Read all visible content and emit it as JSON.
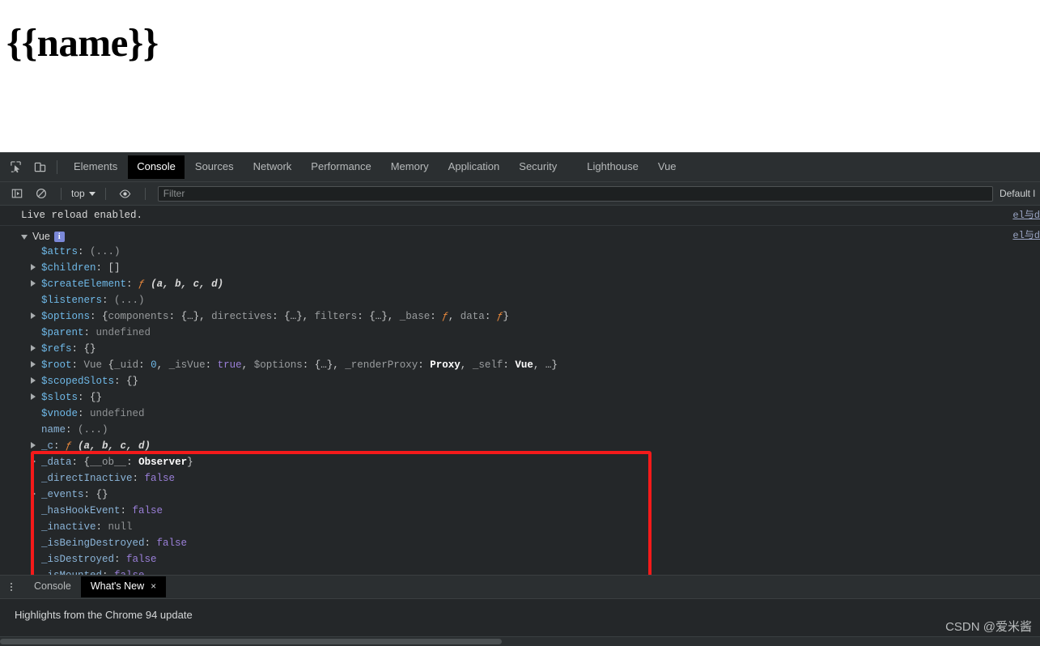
{
  "page": {
    "heading": "{{name}}"
  },
  "devtools": {
    "icons": {
      "inspect": "inspect-element-icon",
      "device": "device-toolbar-icon"
    },
    "tabs": [
      {
        "label": "Elements",
        "active": false
      },
      {
        "label": "Console",
        "active": true
      },
      {
        "label": "Sources",
        "active": false
      },
      {
        "label": "Network",
        "active": false
      },
      {
        "label": "Performance",
        "active": false
      },
      {
        "label": "Memory",
        "active": false
      },
      {
        "label": "Application",
        "active": false
      },
      {
        "label": "Security",
        "active": false
      },
      {
        "label": "Lighthouse",
        "active": false
      },
      {
        "label": "Vue",
        "active": false
      }
    ]
  },
  "console_toolbar": {
    "sidebar_toggle_icon": "console-sidebar-icon",
    "clear_icon": "clear-console-icon",
    "context": "top",
    "eye_icon": "live-expression-eye-icon",
    "filter_placeholder": "Filter",
    "filter_value": "",
    "levels": "Default l"
  },
  "console": {
    "messages": [
      {
        "text": "Live reload enabled.",
        "source": "el与d"
      }
    ],
    "object_group": {
      "label": "Vue",
      "badge": "i",
      "source": "el与d",
      "properties": [
        {
          "expandable": false,
          "key": "$attrs",
          "key_style": "own",
          "parts": [
            {
              "t": ": ",
              "c": "punct"
            },
            {
              "t": "(...)",
              "c": "v-dim"
            }
          ]
        },
        {
          "expandable": true,
          "key": "$children",
          "key_style": "own",
          "parts": [
            {
              "t": ": ",
              "c": "punct"
            },
            {
              "t": "[]",
              "c": "v-obj"
            }
          ]
        },
        {
          "expandable": true,
          "key": "$createElement",
          "key_style": "own",
          "parts": [
            {
              "t": ": ",
              "c": "punct"
            },
            {
              "t": "ƒ ",
              "c": "v-fn"
            },
            {
              "t": "(a, b, c, d)",
              "c": "v-args"
            }
          ]
        },
        {
          "expandable": false,
          "key": "$listeners",
          "key_style": "own",
          "parts": [
            {
              "t": ": ",
              "c": "punct"
            },
            {
              "t": "(...)",
              "c": "v-dim"
            }
          ]
        },
        {
          "expandable": true,
          "key": "$options",
          "key_style": "own",
          "parts": [
            {
              "t": ": ",
              "c": "punct"
            },
            {
              "t": "{",
              "c": "v-obj"
            },
            {
              "t": "components",
              "c": "v-dim"
            },
            {
              "t": ": ",
              "c": "punct"
            },
            {
              "t": "{…}",
              "c": "v-obj"
            },
            {
              "t": ", ",
              "c": "punct"
            },
            {
              "t": "directives",
              "c": "v-dim"
            },
            {
              "t": ": ",
              "c": "punct"
            },
            {
              "t": "{…}",
              "c": "v-obj"
            },
            {
              "t": ", ",
              "c": "punct"
            },
            {
              "t": "filters",
              "c": "v-dim"
            },
            {
              "t": ": ",
              "c": "punct"
            },
            {
              "t": "{…}",
              "c": "v-obj"
            },
            {
              "t": ", ",
              "c": "punct"
            },
            {
              "t": "_base",
              "c": "v-dim"
            },
            {
              "t": ": ",
              "c": "punct"
            },
            {
              "t": "ƒ",
              "c": "v-fn"
            },
            {
              "t": ", ",
              "c": "punct"
            },
            {
              "t": "data",
              "c": "v-dim"
            },
            {
              "t": ": ",
              "c": "punct"
            },
            {
              "t": "ƒ",
              "c": "v-fn"
            },
            {
              "t": "}",
              "c": "v-obj"
            }
          ]
        },
        {
          "expandable": false,
          "key": "$parent",
          "key_style": "own",
          "parts": [
            {
              "t": ": ",
              "c": "punct"
            },
            {
              "t": "undefined",
              "c": "v-undef"
            }
          ]
        },
        {
          "expandable": true,
          "key": "$refs",
          "key_style": "own",
          "parts": [
            {
              "t": ": ",
              "c": "punct"
            },
            {
              "t": "{}",
              "c": "v-obj"
            }
          ]
        },
        {
          "expandable": true,
          "key": "$root",
          "key_style": "own",
          "parts": [
            {
              "t": ": ",
              "c": "punct"
            },
            {
              "t": "Vue ",
              "c": "v-dim"
            },
            {
              "t": "{",
              "c": "v-obj"
            },
            {
              "t": "_uid",
              "c": "v-dim"
            },
            {
              "t": ": ",
              "c": "punct"
            },
            {
              "t": "0",
              "c": "v-num"
            },
            {
              "t": ", ",
              "c": "punct"
            },
            {
              "t": "_isVue",
              "c": "v-dim"
            },
            {
              "t": ": ",
              "c": "punct"
            },
            {
              "t": "true",
              "c": "v-bool"
            },
            {
              "t": ", ",
              "c": "punct"
            },
            {
              "t": "$options",
              "c": "v-dim"
            },
            {
              "t": ": ",
              "c": "punct"
            },
            {
              "t": "{…}",
              "c": "v-obj"
            },
            {
              "t": ", ",
              "c": "punct"
            },
            {
              "t": "_renderProxy",
              "c": "v-dim"
            },
            {
              "t": ": ",
              "c": "punct"
            },
            {
              "t": "Proxy",
              "c": "v-bold"
            },
            {
              "t": ", ",
              "c": "punct"
            },
            {
              "t": "_self",
              "c": "v-dim"
            },
            {
              "t": ": ",
              "c": "punct"
            },
            {
              "t": "Vue",
              "c": "v-bold"
            },
            {
              "t": ", …}",
              "c": "v-obj"
            }
          ]
        },
        {
          "expandable": true,
          "key": "$scopedSlots",
          "key_style": "own",
          "parts": [
            {
              "t": ": ",
              "c": "punct"
            },
            {
              "t": "{}",
              "c": "v-obj"
            }
          ]
        },
        {
          "expandable": true,
          "key": "$slots",
          "key_style": "own",
          "parts": [
            {
              "t": ": ",
              "c": "punct"
            },
            {
              "t": "{}",
              "c": "v-obj"
            }
          ]
        },
        {
          "expandable": false,
          "key": "$vnode",
          "key_style": "own",
          "parts": [
            {
              "t": ": ",
              "c": "punct"
            },
            {
              "t": "undefined",
              "c": "v-undef"
            }
          ]
        },
        {
          "expandable": false,
          "key": "name",
          "key_style": "plain",
          "parts": [
            {
              "t": ": ",
              "c": "punct"
            },
            {
              "t": "(...)",
              "c": "v-dim"
            }
          ]
        },
        {
          "expandable": true,
          "key": "_c",
          "key_style": "plain",
          "parts": [
            {
              "t": ": ",
              "c": "punct"
            },
            {
              "t": "ƒ ",
              "c": "v-fn"
            },
            {
              "t": "(a, b, c, d)",
              "c": "v-args"
            }
          ]
        },
        {
          "expandable": true,
          "key": "_data",
          "key_style": "plain",
          "parts": [
            {
              "t": ": ",
              "c": "punct"
            },
            {
              "t": "{",
              "c": "v-obj"
            },
            {
              "t": "__ob__",
              "c": "v-dim"
            },
            {
              "t": ": ",
              "c": "punct"
            },
            {
              "t": "Observer",
              "c": "v-bold"
            },
            {
              "t": "}",
              "c": "v-obj"
            }
          ]
        },
        {
          "expandable": false,
          "key": "_directInactive",
          "key_style": "plain",
          "parts": [
            {
              "t": ": ",
              "c": "punct"
            },
            {
              "t": "false",
              "c": "v-bool"
            }
          ]
        },
        {
          "expandable": true,
          "key": "_events",
          "key_style": "plain",
          "parts": [
            {
              "t": ": ",
              "c": "punct"
            },
            {
              "t": "{}",
              "c": "v-obj"
            }
          ]
        },
        {
          "expandable": false,
          "key": "_hasHookEvent",
          "key_style": "plain",
          "parts": [
            {
              "t": ": ",
              "c": "punct"
            },
            {
              "t": "false",
              "c": "v-bool"
            }
          ]
        },
        {
          "expandable": false,
          "key": "_inactive",
          "key_style": "plain",
          "parts": [
            {
              "t": ": ",
              "c": "punct"
            },
            {
              "t": "null",
              "c": "v-null"
            }
          ]
        },
        {
          "expandable": false,
          "key": "_isBeingDestroyed",
          "key_style": "plain",
          "parts": [
            {
              "t": ": ",
              "c": "punct"
            },
            {
              "t": "false",
              "c": "v-bool"
            }
          ]
        },
        {
          "expandable": false,
          "key": "_isDestroyed",
          "key_style": "plain",
          "parts": [
            {
              "t": ": ",
              "c": "punct"
            },
            {
              "t": "false",
              "c": "v-bool"
            }
          ]
        },
        {
          "expandable": false,
          "key": "_isMounted",
          "key_style": "plain",
          "parts": [
            {
              "t": ": ",
              "c": "punct"
            },
            {
              "t": "false",
              "c": "v-bool"
            }
          ]
        }
      ]
    }
  },
  "drawer": {
    "tabs": [
      {
        "label": "Console",
        "active": false,
        "closable": false
      },
      {
        "label": "What's New",
        "active": true,
        "closable": true
      }
    ],
    "close_glyph": "×",
    "content": "Highlights from the Chrome 94 update"
  },
  "watermark": "CSDN @爱米酱",
  "colors": {
    "accent_red": "#f41a1a",
    "panel_bg": "#242729",
    "toolbar_bg": "#2b2f31",
    "active_tab_bg": "#000000",
    "key_blue": "#6fb9e8",
    "bool_purple": "#9a7fd8",
    "badge_blue": "#7b88d8"
  }
}
